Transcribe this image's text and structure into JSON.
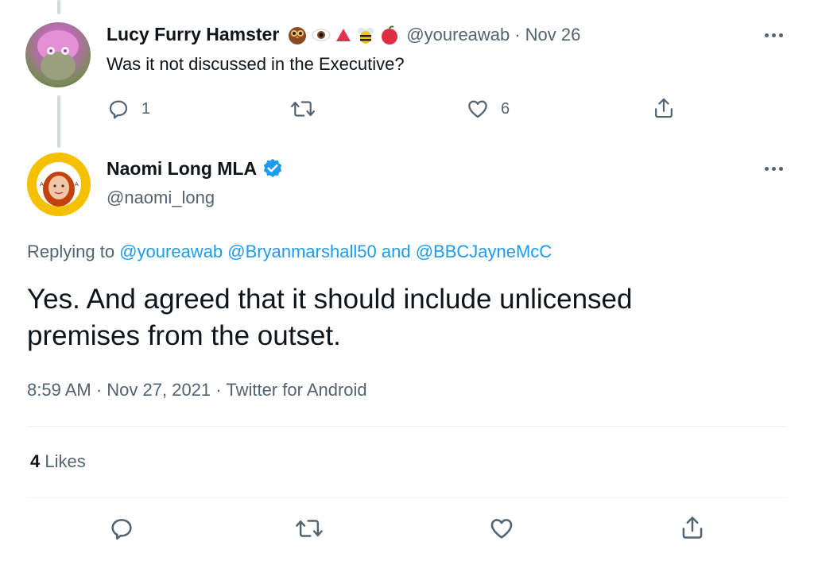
{
  "reply_tweet": {
    "author_name": "Lucy Furry Hamster",
    "emoji_names": [
      "owl-emoji",
      "eye-emoji",
      "red-triangle-emoji",
      "bee-emoji",
      "apple-emoji"
    ],
    "handle": "@youreawab",
    "separator": "·",
    "date": "Nov 26",
    "text": "Was it not discussed in the Executive?",
    "reply_count": "1",
    "like_count": "6"
  },
  "main_tweet": {
    "author_name": "Naomi Long MLA",
    "handle": "@naomi_long",
    "replying_label": "Replying to",
    "replying_to": [
      "@youreawab",
      "@Bryanmarshall50"
    ],
    "replying_and": "and",
    "replying_last": "@BBCJayneMcC",
    "text_line1": "Yes. And agreed that it should include unlicensed",
    "text_line2": "premises from the outset.",
    "time": "8:59 AM",
    "sep1": "·",
    "date": "Nov 27, 2021",
    "sep2": "·",
    "source": "Twitter for Android",
    "likes_count": "4",
    "likes_label": "Likes"
  },
  "colors": {
    "text": "#0f1419",
    "muted": "#536471",
    "link": "#1d9bf0",
    "verified": "#1d9bf0",
    "divider": "#eff3f4",
    "thread_line": "#cfd9de"
  }
}
